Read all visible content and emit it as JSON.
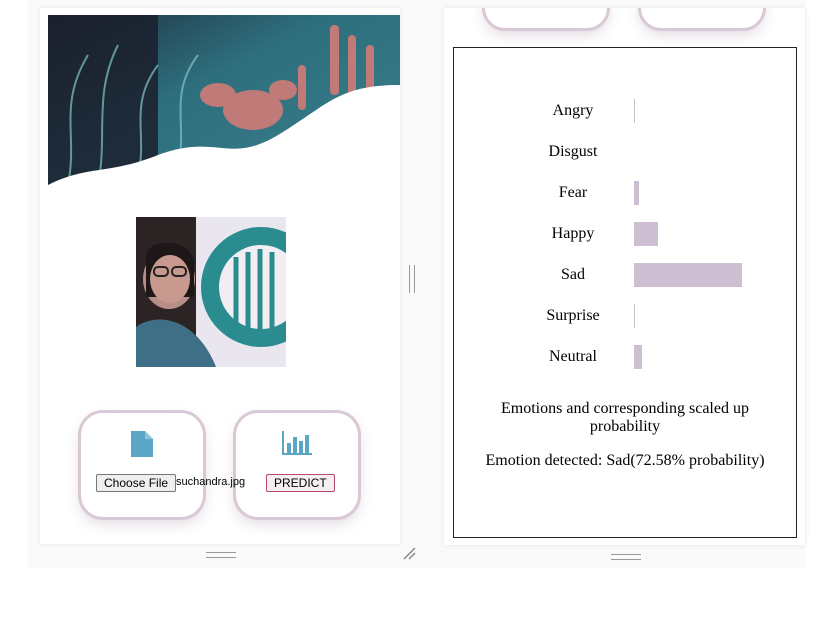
{
  "upload": {
    "file_button": "Choose File",
    "file_name": "suchandra.jpg",
    "predict_button": "PREDICT"
  },
  "results": {
    "emotions": [
      {
        "label": "Angry",
        "probability": 0.6
      },
      {
        "label": "Disgust",
        "probability": 0.0
      },
      {
        "label": "Fear",
        "probability": 3.5
      },
      {
        "label": "Happy",
        "probability": 16.0
      },
      {
        "label": "Sad",
        "probability": 72.58
      },
      {
        "label": "Surprise",
        "probability": 0.5
      },
      {
        "label": "Neutral",
        "probability": 5.5
      }
    ],
    "caption": "Emotions and corresponding scaled up probability",
    "detected": "Emotion detected: Sad(72.58% probability)"
  },
  "colors": {
    "bar": "#cdbfd1",
    "icon": "#5aa6c4",
    "card_border": "#d9c9d6"
  },
  "icons": {
    "upload": "file-icon",
    "predict": "bar-chart-icon"
  }
}
